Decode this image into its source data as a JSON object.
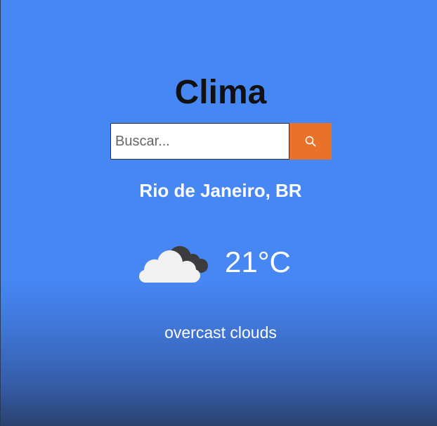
{
  "app": {
    "title": "Clima"
  },
  "search": {
    "placeholder": "Buscar...",
    "button_icon": "search-icon"
  },
  "weather": {
    "location": "Rio de Janeiro, BR",
    "icon": "overcast-clouds-icon",
    "temperature": "21°C",
    "description": "overcast clouds"
  },
  "colors": {
    "background": "#4687f4",
    "background_bottom": "#2b426f",
    "search_button": "#e8722a",
    "title_text": "#111111",
    "text": "#ffffff"
  }
}
